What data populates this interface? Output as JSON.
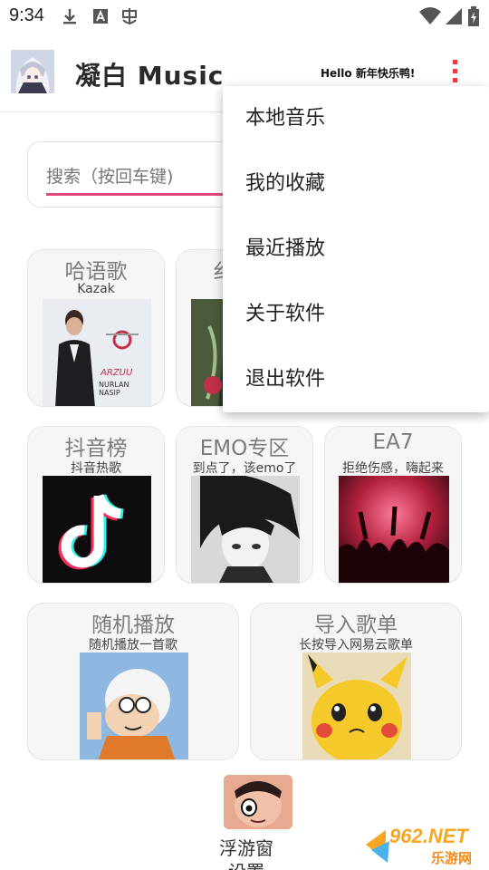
{
  "status_bar": {
    "time": "9:34",
    "left_icons": [
      "download-icon",
      "font-icon",
      "bug-icon"
    ],
    "right_icons": [
      "wifi-icon",
      "signal-icon",
      "battery-icon"
    ]
  },
  "header": {
    "title": "凝白 Music",
    "greeting": "Hello 新年快乐鸭!",
    "avatar_icon": "anime-avatar-icon",
    "more_icon": "more-vertical-icon"
  },
  "search": {
    "placeholder": "搜索（按回车键)"
  },
  "cards": [
    {
      "title": "哈语歌",
      "subtitle": "Kazak",
      "art": "kazak-album-art",
      "art_text": "ARZUU",
      "art_subtext": "NURLAN NASIP"
    },
    {
      "title": "纟",
      "subtitle": "",
      "art": "guitar-art"
    },
    {
      "title": "抖音榜",
      "subtitle": "抖音热歌",
      "art": "tiktok-logo"
    },
    {
      "title": "EMO专区",
      "subtitle": "到点了，该emo了",
      "art": "emo-manga-art"
    },
    {
      "title": "EA7",
      "subtitle": "拒绝伤感，嗨起来",
      "art": "party-crowd-art"
    },
    {
      "title": "随机播放",
      "subtitle": "随机播放一首歌",
      "art": "cartoon-boy-art"
    },
    {
      "title": "导入歌单",
      "subtitle": "长按导入网易云歌单",
      "art": "pikachu-art"
    }
  ],
  "menu": {
    "items": [
      "本地音乐",
      "我的收藏",
      "最近播放",
      "关于软件",
      "退出软件"
    ]
  },
  "floating": {
    "label": "浮游窗设置",
    "icon": "face-icon"
  },
  "watermark": {
    "text": "962.NET",
    "subtext": "乐游网"
  },
  "colors": {
    "accent": "#e44a7c",
    "menu_dots": "#e83c3c",
    "card_bg": "#f6f6f6"
  }
}
